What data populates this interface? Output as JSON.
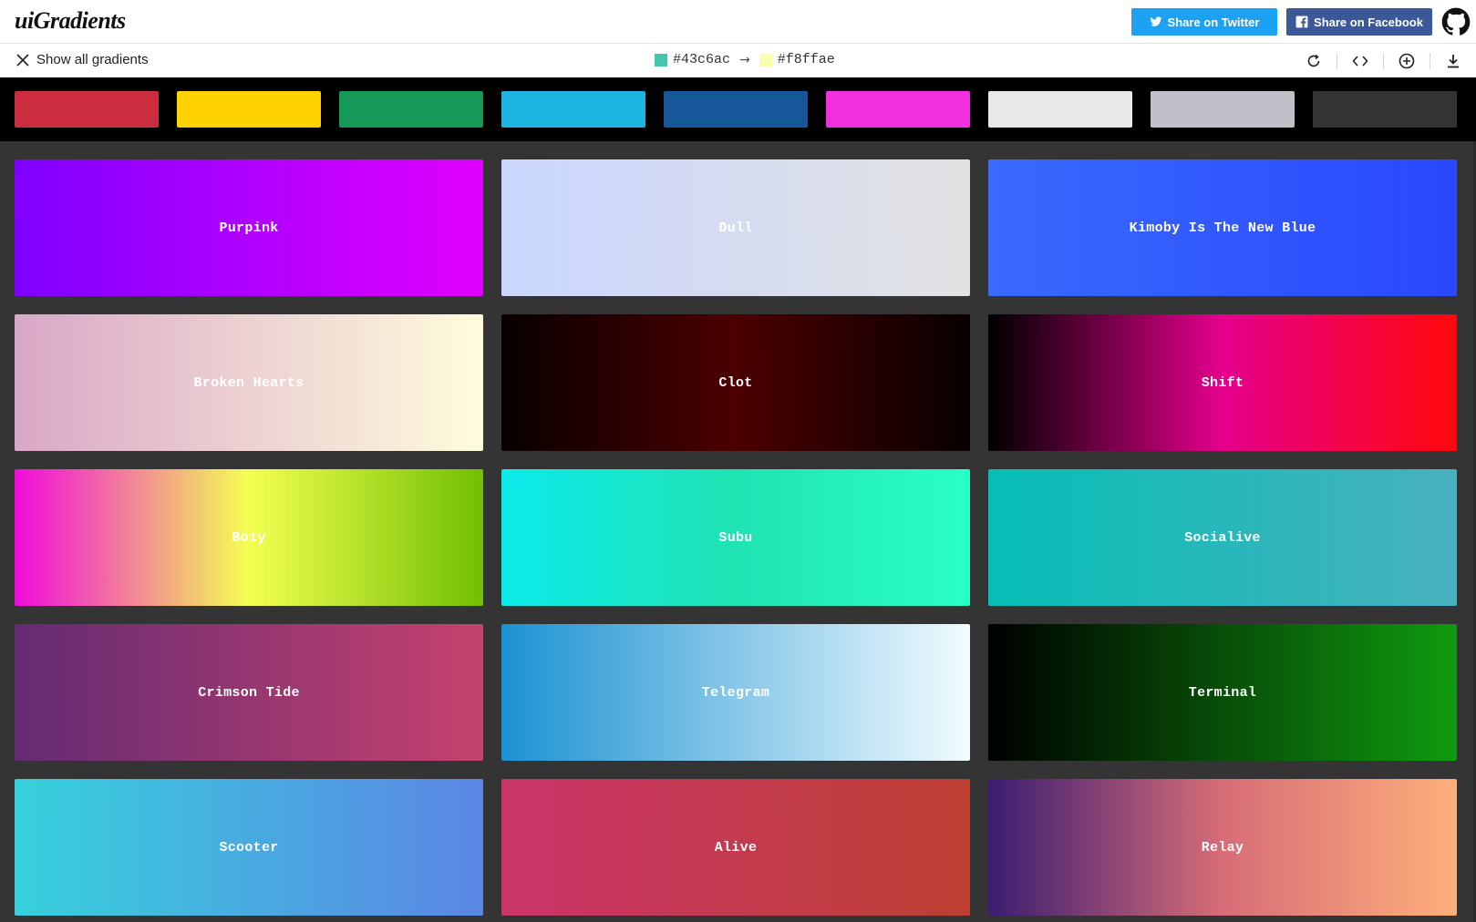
{
  "header": {
    "logo": "uiGradients",
    "share_twitter": "Share on Twitter",
    "share_facebook": "Share on Facebook"
  },
  "subbar": {
    "show_all": "Show all gradients",
    "current_from": "#43c6ac",
    "current_to": "#f8ffae",
    "current_from_color": "#43c6ac",
    "current_to_color": "#f8ffae"
  },
  "filters": [
    {
      "name": "red",
      "color": "#cb2d3e"
    },
    {
      "name": "yellow",
      "color": "#ffd200"
    },
    {
      "name": "green",
      "color": "#159957"
    },
    {
      "name": "blue",
      "color": "#1fb5e2"
    },
    {
      "name": "darkblue",
      "color": "#155799"
    },
    {
      "name": "pink",
      "color": "#f230e0"
    },
    {
      "name": "white",
      "color": "#e8e8e8"
    },
    {
      "name": "grey",
      "color": "#c0c0c8"
    },
    {
      "name": "black",
      "color": "#333333"
    }
  ],
  "gradients": [
    {
      "name": "Purpink",
      "colors": [
        "#7f00ff",
        "#e100ff"
      ],
      "dir": "to right"
    },
    {
      "name": "Dull",
      "colors": [
        "#c9d6ff",
        "#e2e2e2"
      ],
      "dir": "to right"
    },
    {
      "name": "Kimoby Is The New Blue",
      "colors": [
        "#396afc",
        "#2948ff"
      ],
      "dir": "to right"
    },
    {
      "name": "Broken Hearts",
      "colors": [
        "#d9a7c7",
        "#fffcdc"
      ],
      "dir": "to right"
    },
    {
      "name": "Clot",
      "colors": [
        "#070000",
        "#4c0001",
        "#070000"
      ],
      "dir": "to right"
    },
    {
      "name": "Shift",
      "colors": [
        "#000000",
        "#e5008d",
        "#ff070b"
      ],
      "dir": "to right"
    },
    {
      "name": "Boiy",
      "colors": [
        "#f00bdb",
        "#f4ff52",
        "#70c000"
      ],
      "dir": "to right"
    },
    {
      "name": "Subu",
      "colors": [
        "#0cebeb",
        "#20e3b2",
        "#29ffc6"
      ],
      "dir": "to right"
    },
    {
      "name": "Socialive",
      "colors": [
        "#06beb6",
        "#48b1bf"
      ],
      "dir": "to right"
    },
    {
      "name": "Crimson Tide",
      "colors": [
        "#642b73",
        "#c6426e"
      ],
      "dir": "to right"
    },
    {
      "name": "Telegram",
      "colors": [
        "#1c92d2",
        "#f2fcfe"
      ],
      "dir": "to right"
    },
    {
      "name": "Terminal",
      "colors": [
        "#000000",
        "#0f9b0f"
      ],
      "dir": "to right"
    },
    {
      "name": "Scooter",
      "colors": [
        "#36d1dc",
        "#5b86e5"
      ],
      "dir": "to right"
    },
    {
      "name": "Alive",
      "colors": [
        "#cb356b",
        "#bd3f32"
      ],
      "dir": "to right"
    },
    {
      "name": "Relay",
      "colors": [
        "#3a1c71",
        "#d76d77",
        "#ffaf7b"
      ],
      "dir": "to right"
    }
  ]
}
